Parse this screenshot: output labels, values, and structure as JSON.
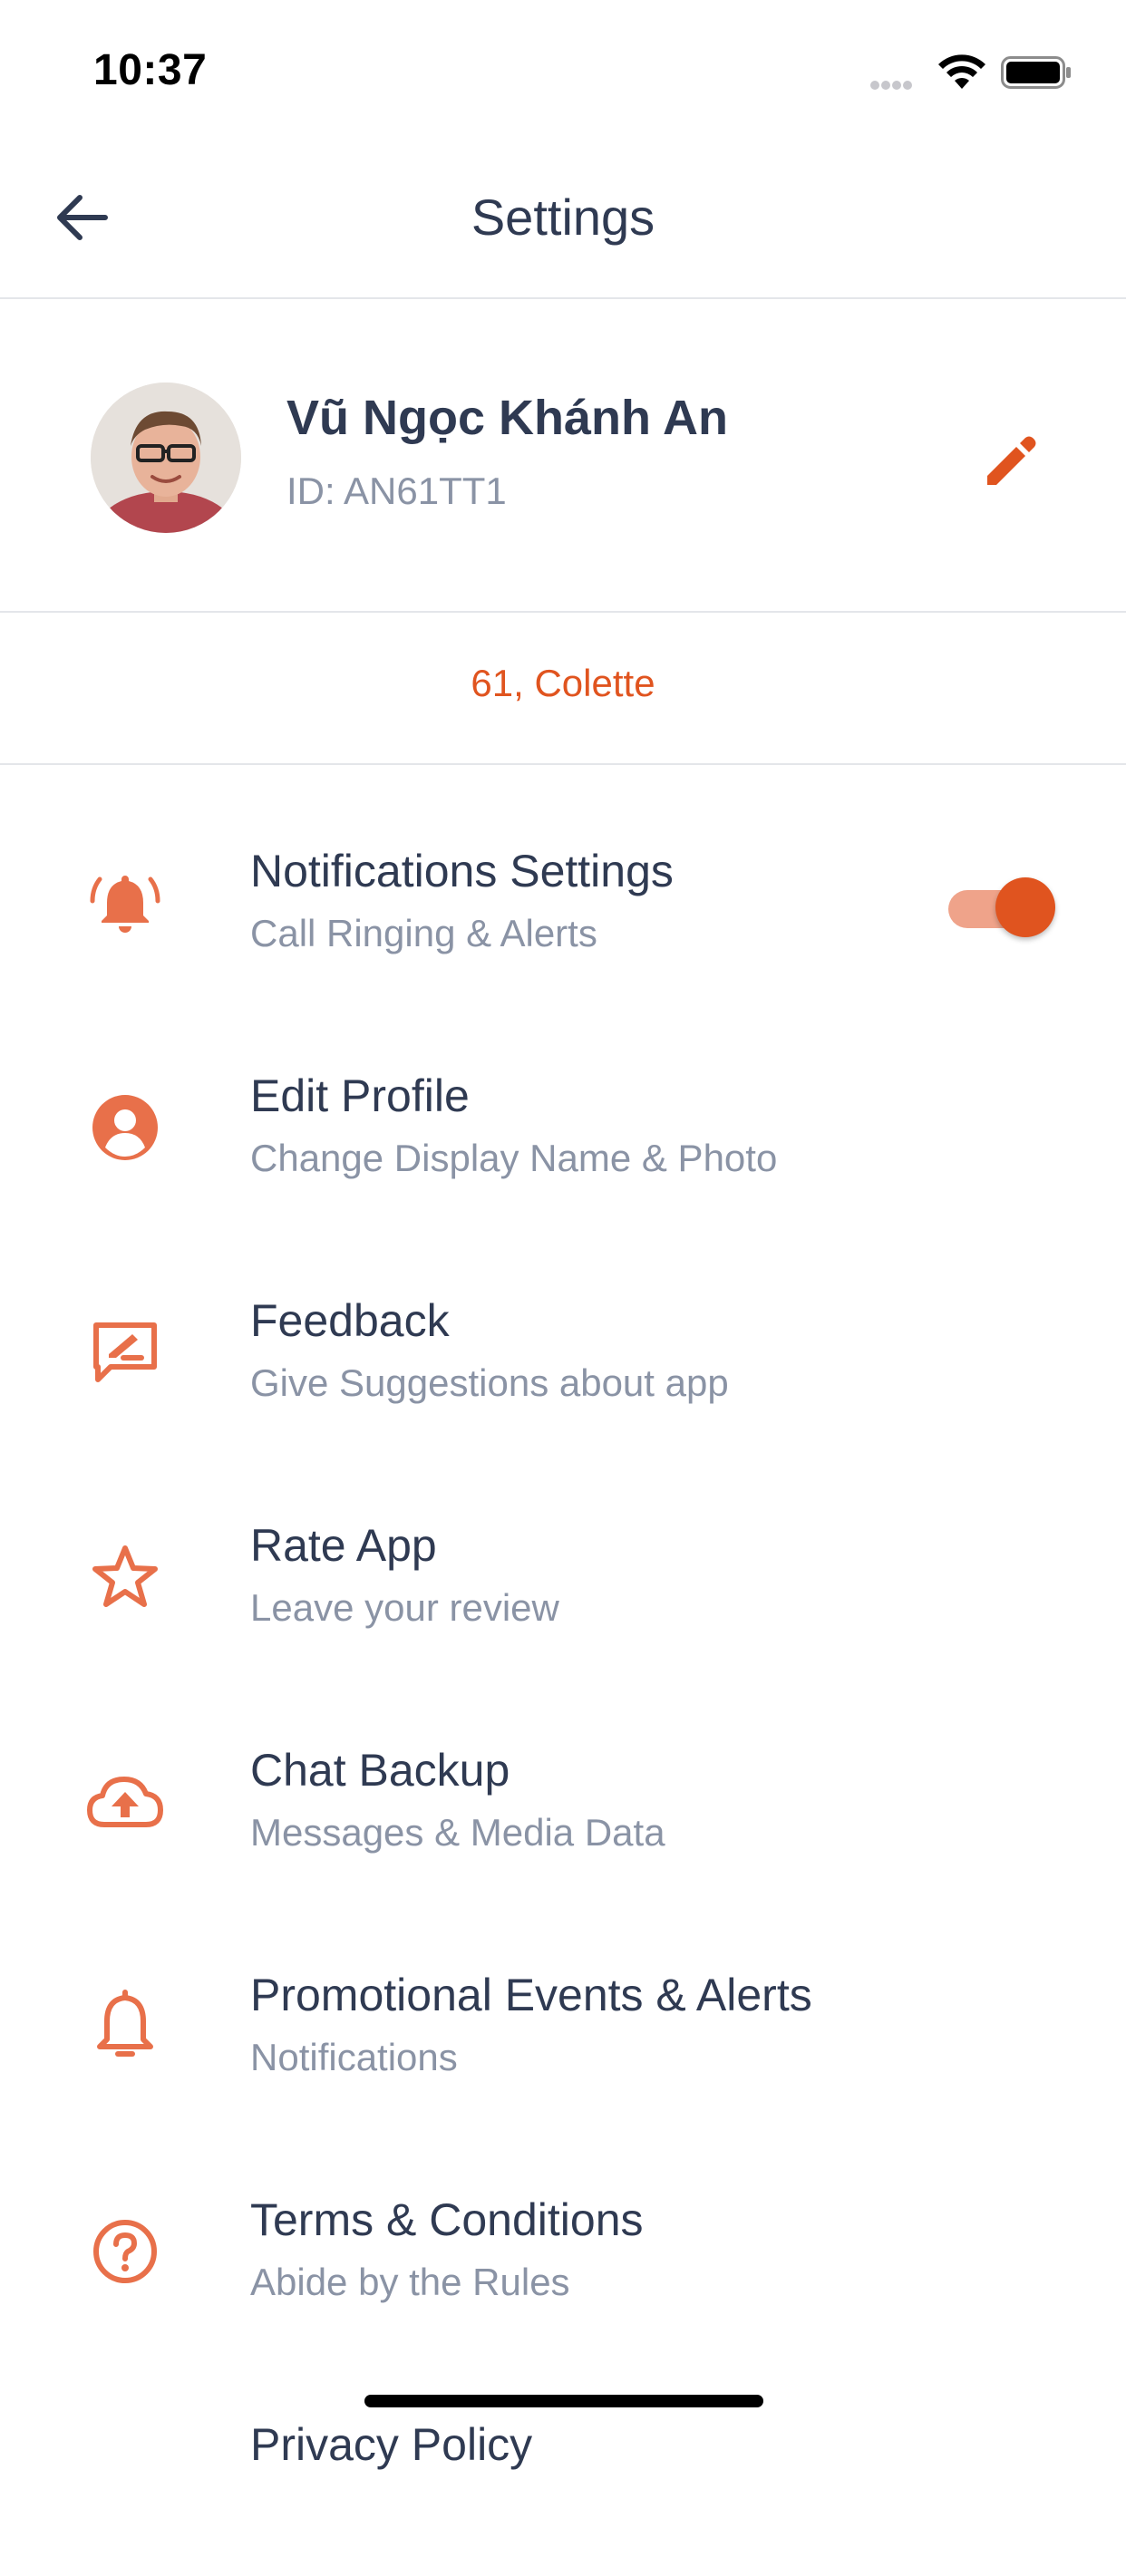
{
  "status_bar": {
    "time": "10:37"
  },
  "header": {
    "title": "Settings"
  },
  "profile": {
    "name": "Vũ Ngọc Khánh An",
    "id": "ID: AN61TT1"
  },
  "location": "61, Colette",
  "colors": {
    "accent": "#e0541f",
    "icon": "#e8704a",
    "text": "#2f3a52",
    "subtext": "#8a93a5"
  },
  "menu": [
    {
      "title": "Notifications Settings",
      "subtitle": "Call Ringing & Alerts",
      "icon": "bell-ringing-icon",
      "toggle": true
    },
    {
      "title": "Edit Profile",
      "subtitle": "Change Display Name & Photo",
      "icon": "user-circle-icon"
    },
    {
      "title": "Feedback",
      "subtitle": "Give Suggestions about app",
      "icon": "feedback-icon"
    },
    {
      "title": "Rate App",
      "subtitle": "Leave your review",
      "icon": "star-icon"
    },
    {
      "title": "Chat Backup",
      "subtitle": "Messages & Media Data",
      "icon": "cloud-upload-icon"
    },
    {
      "title": "Promotional Events & Alerts",
      "subtitle": "Notifications",
      "icon": "bell-icon"
    },
    {
      "title": "Terms & Conditions",
      "subtitle": "Abide by the Rules",
      "icon": "help-circle-icon"
    },
    {
      "title": "Privacy Policy",
      "subtitle": "",
      "icon": ""
    }
  ]
}
